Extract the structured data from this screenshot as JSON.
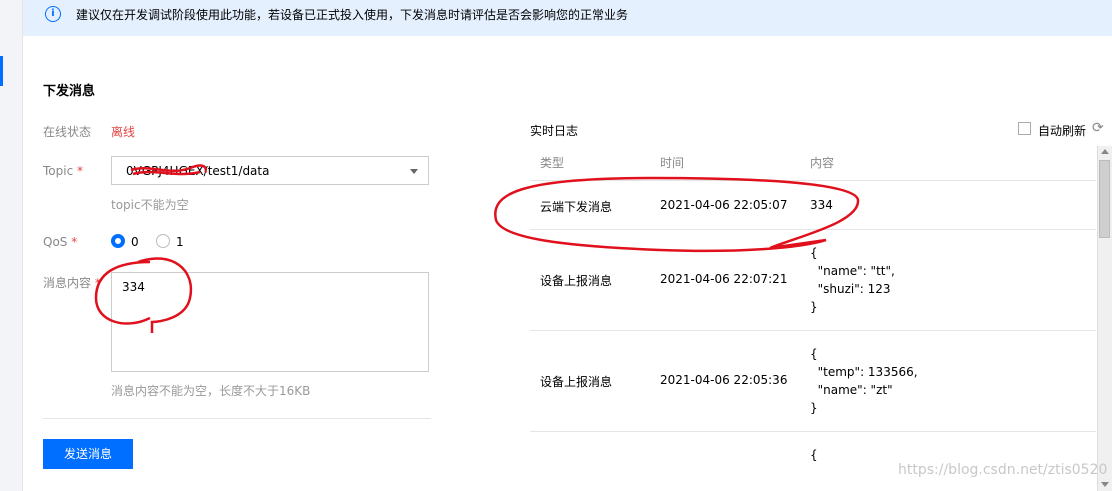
{
  "notice": {
    "text": "建议仅在开发调试阶段使用此功能，若设备已正式投入使用，下发消息时请评估是否会影响您的正常业务"
  },
  "form": {
    "title": "下发消息",
    "status_label": "在线状态",
    "status_value": "离线",
    "topic_label": "Topic",
    "required_mark": "*",
    "topic_value": "0VGPJ4HGEX/test1/data",
    "topic_hint": "topic不能为空",
    "qos_label": "QoS",
    "qos_options": [
      "0",
      "1"
    ],
    "qos_selected": "0",
    "content_label": "消息内容",
    "content_value": "334",
    "content_hint": "消息内容不能为空，长度不大于16KB",
    "send_button": "发送消息"
  },
  "log": {
    "title": "实时日志",
    "auto_refresh_label": "自动刷新",
    "auto_refresh_checked": false,
    "columns": [
      "类型",
      "时间",
      "内容"
    ],
    "rows": [
      {
        "type": "云端下发消息",
        "time": "2021-04-06 22:05:07",
        "content": "334"
      },
      {
        "type": "设备上报消息",
        "time": "2021-04-06 22:07:21",
        "content": "{\n  \"name\": \"tt\",\n  \"shuzi\": 123\n}"
      },
      {
        "type": "设备上报消息",
        "time": "2021-04-06 22:05:36",
        "content": "{\n  \"temp\": 133566,\n  \"name\": \"zt\"\n}"
      },
      {
        "type": "",
        "time": "",
        "content": "{"
      }
    ]
  },
  "watermark": "https://blog.csdn.net/ztis0520",
  "colors": {
    "accent": "#006eff",
    "offline": "#e54545",
    "annotation": "#e0101c"
  }
}
